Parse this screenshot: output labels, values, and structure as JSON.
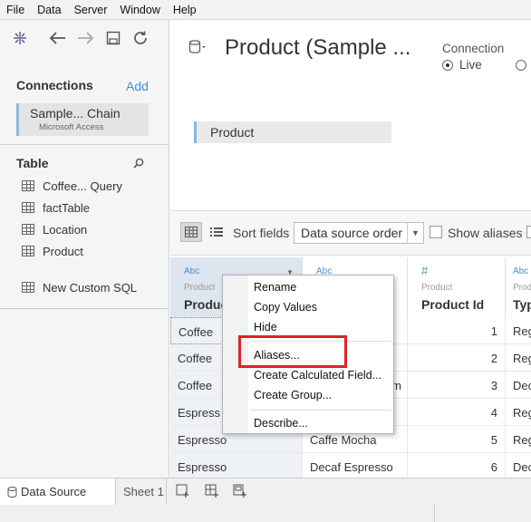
{
  "menu": [
    "File",
    "Data",
    "Server",
    "Window",
    "Help"
  ],
  "connections": {
    "title": "Connections",
    "add_label": "Add",
    "item_name": "Sample... Chain",
    "item_type": "Microsoft Access"
  },
  "table_section": {
    "title": "Table",
    "items": [
      "Coffee... Query",
      "factTable",
      "Location",
      "Product"
    ],
    "custom_sql": "New Custom SQL"
  },
  "datasource": {
    "title": "Product (Sample ...",
    "connection_label": "Connection",
    "live_label": "Live",
    "canvas_table": "Product"
  },
  "grid_toolbar": {
    "sort_label": "Sort fields",
    "sort_value": "Data source order",
    "show_aliases": "Show aliases"
  },
  "columns": [
    {
      "type": "Abc",
      "source": "Product",
      "name": "Produc"
    },
    {
      "type": "Abc",
      "source": "",
      "name": ""
    },
    {
      "type": "#",
      "source": "Product",
      "name": "Product Id"
    },
    {
      "type": "Abc",
      "source": "Prod",
      "name": "Typ"
    }
  ],
  "rows": [
    [
      "Coffee",
      "",
      "1",
      "Reg"
    ],
    [
      "Coffee",
      "",
      "2",
      "Reg"
    ],
    [
      "Coffee",
      "m",
      "3",
      "Dec"
    ],
    [
      "Espress",
      "",
      "4",
      "Reg"
    ],
    [
      "Espresso",
      "Caffe Mocha",
      "5",
      "Reg"
    ],
    [
      "Espresso",
      "Decaf Espresso",
      "6",
      "Dec"
    ]
  ],
  "context_menu": {
    "items": [
      "Rename",
      "Copy Values",
      "Hide",
      "Aliases...",
      "Create Calculated Field...",
      "Create Group...",
      "Describe..."
    ]
  },
  "tabs": {
    "datasource": "Data Source",
    "sheet": "Sheet 1"
  },
  "colors": {
    "accent": "#4a90c9",
    "highlight_box": "#e0202a"
  }
}
